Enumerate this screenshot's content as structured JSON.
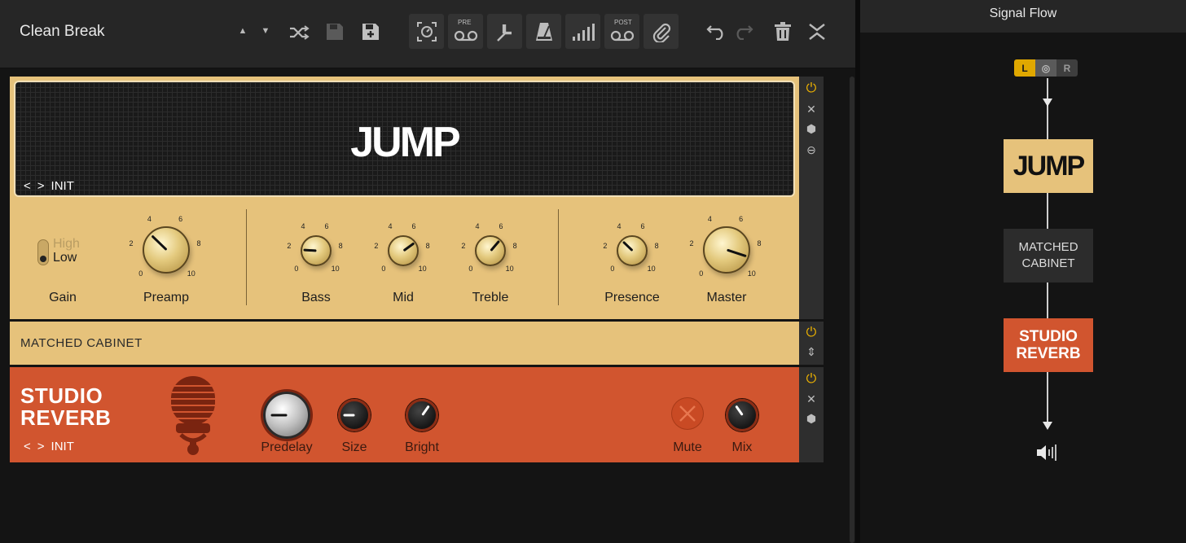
{
  "toolbar": {
    "preset_name": "Clean Break",
    "pre_label": "PRE",
    "post_label": "POST"
  },
  "amp": {
    "name": "JUMP",
    "preset": "INIT",
    "switch": {
      "high": "High",
      "low": "Low",
      "label": "Gain",
      "selected": "Low"
    },
    "knobs": [
      {
        "label": "Preamp",
        "value": 3.3
      },
      {
        "label": "Bass",
        "value": 1.8
      },
      {
        "label": "Mid",
        "value": 7.0
      },
      {
        "label": "Treble",
        "value": 6.5
      },
      {
        "label": "Presence",
        "value": 3.3
      },
      {
        "label": "Master",
        "value": 9.0
      }
    ],
    "scale": {
      "s0": "0",
      "s2": "2",
      "s4": "4",
      "s6": "6",
      "s8": "8",
      "s10": "10"
    }
  },
  "cabinet": {
    "name": "MATCHED CABINET"
  },
  "reverb": {
    "title_line1": "STUDIO",
    "title_line2": "REVERB",
    "preset": "INIT",
    "knobs": [
      {
        "label": "Predelay"
      },
      {
        "label": "Size"
      },
      {
        "label": "Bright"
      },
      {
        "label": "Mix"
      }
    ],
    "mute_label": "Mute"
  },
  "signal_flow": {
    "title": "Signal Flow",
    "channel": {
      "left": "L",
      "right": "R",
      "selected": "L"
    },
    "blocks": {
      "amp": "JUMP",
      "cab_line1": "MATCHED",
      "cab_line2": "CABINET",
      "rev_line1": "STUDIO",
      "rev_line2": "REVERB"
    }
  },
  "colors": {
    "amp": "#e6c27b",
    "reverb": "#d1552f",
    "power": "#f0b400"
  }
}
